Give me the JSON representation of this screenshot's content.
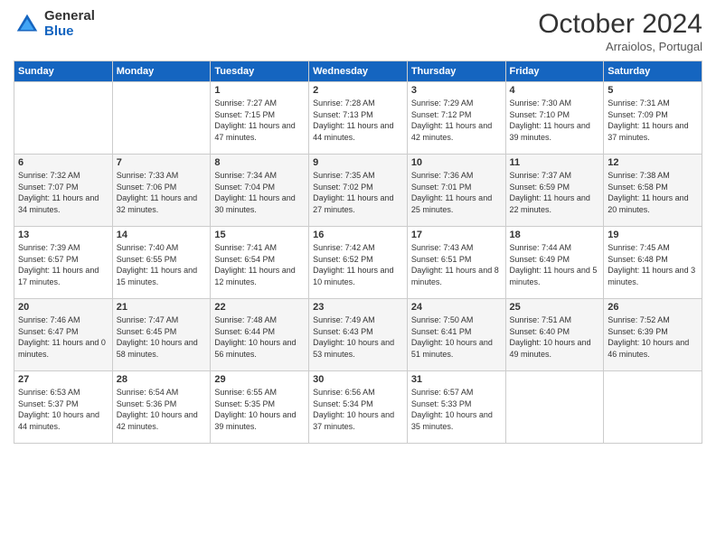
{
  "logo": {
    "general": "General",
    "blue": "Blue"
  },
  "title": "October 2024",
  "location": "Arraiolos, Portugal",
  "days_header": [
    "Sunday",
    "Monday",
    "Tuesday",
    "Wednesday",
    "Thursday",
    "Friday",
    "Saturday"
  ],
  "weeks": [
    [
      {
        "day": "",
        "info": ""
      },
      {
        "day": "",
        "info": ""
      },
      {
        "day": "1",
        "info": "Sunrise: 7:27 AM\nSunset: 7:15 PM\nDaylight: 11 hours and 47 minutes."
      },
      {
        "day": "2",
        "info": "Sunrise: 7:28 AM\nSunset: 7:13 PM\nDaylight: 11 hours and 44 minutes."
      },
      {
        "day": "3",
        "info": "Sunrise: 7:29 AM\nSunset: 7:12 PM\nDaylight: 11 hours and 42 minutes."
      },
      {
        "day": "4",
        "info": "Sunrise: 7:30 AM\nSunset: 7:10 PM\nDaylight: 11 hours and 39 minutes."
      },
      {
        "day": "5",
        "info": "Sunrise: 7:31 AM\nSunset: 7:09 PM\nDaylight: 11 hours and 37 minutes."
      }
    ],
    [
      {
        "day": "6",
        "info": "Sunrise: 7:32 AM\nSunset: 7:07 PM\nDaylight: 11 hours and 34 minutes."
      },
      {
        "day": "7",
        "info": "Sunrise: 7:33 AM\nSunset: 7:06 PM\nDaylight: 11 hours and 32 minutes."
      },
      {
        "day": "8",
        "info": "Sunrise: 7:34 AM\nSunset: 7:04 PM\nDaylight: 11 hours and 30 minutes."
      },
      {
        "day": "9",
        "info": "Sunrise: 7:35 AM\nSunset: 7:02 PM\nDaylight: 11 hours and 27 minutes."
      },
      {
        "day": "10",
        "info": "Sunrise: 7:36 AM\nSunset: 7:01 PM\nDaylight: 11 hours and 25 minutes."
      },
      {
        "day": "11",
        "info": "Sunrise: 7:37 AM\nSunset: 6:59 PM\nDaylight: 11 hours and 22 minutes."
      },
      {
        "day": "12",
        "info": "Sunrise: 7:38 AM\nSunset: 6:58 PM\nDaylight: 11 hours and 20 minutes."
      }
    ],
    [
      {
        "day": "13",
        "info": "Sunrise: 7:39 AM\nSunset: 6:57 PM\nDaylight: 11 hours and 17 minutes."
      },
      {
        "day": "14",
        "info": "Sunrise: 7:40 AM\nSunset: 6:55 PM\nDaylight: 11 hours and 15 minutes."
      },
      {
        "day": "15",
        "info": "Sunrise: 7:41 AM\nSunset: 6:54 PM\nDaylight: 11 hours and 12 minutes."
      },
      {
        "day": "16",
        "info": "Sunrise: 7:42 AM\nSunset: 6:52 PM\nDaylight: 11 hours and 10 minutes."
      },
      {
        "day": "17",
        "info": "Sunrise: 7:43 AM\nSunset: 6:51 PM\nDaylight: 11 hours and 8 minutes."
      },
      {
        "day": "18",
        "info": "Sunrise: 7:44 AM\nSunset: 6:49 PM\nDaylight: 11 hours and 5 minutes."
      },
      {
        "day": "19",
        "info": "Sunrise: 7:45 AM\nSunset: 6:48 PM\nDaylight: 11 hours and 3 minutes."
      }
    ],
    [
      {
        "day": "20",
        "info": "Sunrise: 7:46 AM\nSunset: 6:47 PM\nDaylight: 11 hours and 0 minutes."
      },
      {
        "day": "21",
        "info": "Sunrise: 7:47 AM\nSunset: 6:45 PM\nDaylight: 10 hours and 58 minutes."
      },
      {
        "day": "22",
        "info": "Sunrise: 7:48 AM\nSunset: 6:44 PM\nDaylight: 10 hours and 56 minutes."
      },
      {
        "day": "23",
        "info": "Sunrise: 7:49 AM\nSunset: 6:43 PM\nDaylight: 10 hours and 53 minutes."
      },
      {
        "day": "24",
        "info": "Sunrise: 7:50 AM\nSunset: 6:41 PM\nDaylight: 10 hours and 51 minutes."
      },
      {
        "day": "25",
        "info": "Sunrise: 7:51 AM\nSunset: 6:40 PM\nDaylight: 10 hours and 49 minutes."
      },
      {
        "day": "26",
        "info": "Sunrise: 7:52 AM\nSunset: 6:39 PM\nDaylight: 10 hours and 46 minutes."
      }
    ],
    [
      {
        "day": "27",
        "info": "Sunrise: 6:53 AM\nSunset: 5:37 PM\nDaylight: 10 hours and 44 minutes."
      },
      {
        "day": "28",
        "info": "Sunrise: 6:54 AM\nSunset: 5:36 PM\nDaylight: 10 hours and 42 minutes."
      },
      {
        "day": "29",
        "info": "Sunrise: 6:55 AM\nSunset: 5:35 PM\nDaylight: 10 hours and 39 minutes."
      },
      {
        "day": "30",
        "info": "Sunrise: 6:56 AM\nSunset: 5:34 PM\nDaylight: 10 hours and 37 minutes."
      },
      {
        "day": "31",
        "info": "Sunrise: 6:57 AM\nSunset: 5:33 PM\nDaylight: 10 hours and 35 minutes."
      },
      {
        "day": "",
        "info": ""
      },
      {
        "day": "",
        "info": ""
      }
    ]
  ]
}
